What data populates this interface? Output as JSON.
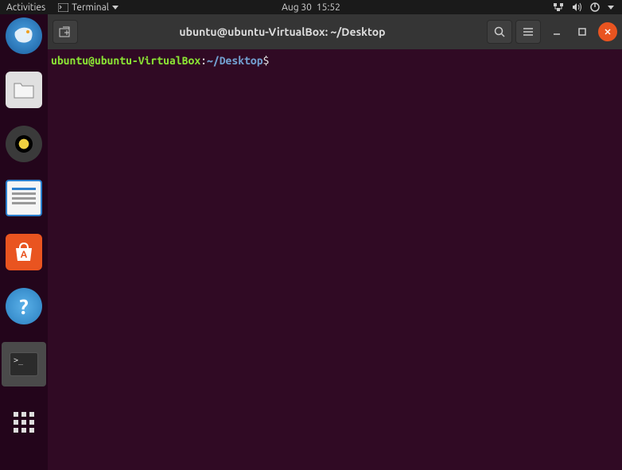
{
  "topbar": {
    "activities": "Activities",
    "app_menu": "Terminal",
    "date": "Aug 30",
    "time": "15:52"
  },
  "dock": {
    "thunderbird": "thunderbird",
    "files": "files",
    "rhythmbox": "rhythmbox",
    "writer": "libreoffice-writer",
    "software": "ubuntu-software",
    "help": "help",
    "help_glyph": "?",
    "terminal": "terminal",
    "terminal_glyph": ">_",
    "show_apps": "show-applications"
  },
  "window": {
    "title": "ubuntu@ubuntu-VirtualBox: ~/Desktop",
    "new_tab": "new-tab",
    "search": "search",
    "menu": "menu",
    "minimize": "minimize",
    "maximize": "maximize",
    "close": "close"
  },
  "terminal": {
    "user_host": "ubuntu@ubuntu-VirtualBox",
    "colon": ":",
    "path": "~/Desktop",
    "prompt_char": "$"
  }
}
